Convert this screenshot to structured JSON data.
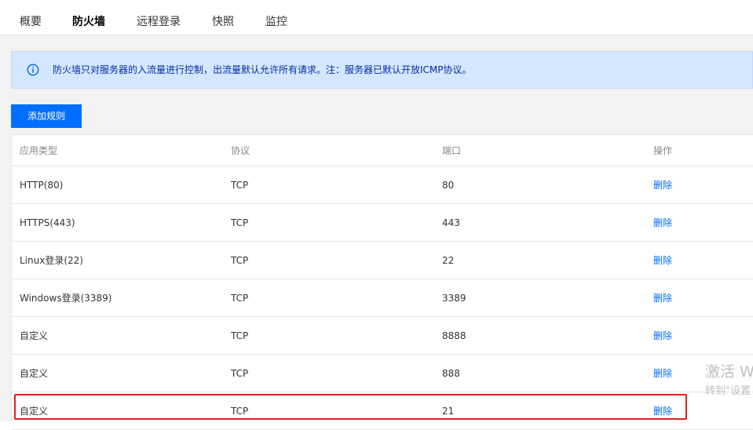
{
  "tabs": [
    {
      "label": "概要",
      "active": false
    },
    {
      "label": "防火墙",
      "active": true
    },
    {
      "label": "远程登录",
      "active": false
    },
    {
      "label": "快照",
      "active": false
    },
    {
      "label": "监控",
      "active": false
    }
  ],
  "notice": {
    "text": "防火墙只对服务器的入流量进行控制，出流量默认允许所有请求。注：服务器已默认开放ICMP协议。",
    "icon": "info-icon"
  },
  "toolbar": {
    "add_label": "添加规则"
  },
  "table": {
    "headers": [
      "应用类型",
      "协议",
      "端口",
      "操作"
    ],
    "rows": [
      {
        "app_type": "HTTP(80)",
        "protocol": "TCP",
        "port": "80",
        "action": "删除"
      },
      {
        "app_type": "HTTPS(443)",
        "protocol": "TCP",
        "port": "443",
        "action": "删除"
      },
      {
        "app_type": "Linux登录(22)",
        "protocol": "TCP",
        "port": "22",
        "action": "删除"
      },
      {
        "app_type": "Windows登录(3389)",
        "protocol": "TCP",
        "port": "3389",
        "action": "删除"
      },
      {
        "app_type": "自定义",
        "protocol": "TCP",
        "port": "8888",
        "action": "删除"
      },
      {
        "app_type": "自定义",
        "protocol": "TCP",
        "port": "888",
        "action": "删除"
      },
      {
        "app_type": "自定义",
        "protocol": "TCP",
        "port": "21",
        "action": "删除"
      }
    ]
  },
  "watermark": {
    "line1": "激活 W",
    "line2": "转到\"设置"
  },
  "colors": {
    "accent": "#006eff",
    "notice_bg": "#d5e7ff",
    "notice_text": "#002da0",
    "highlight": "#e02020"
  }
}
